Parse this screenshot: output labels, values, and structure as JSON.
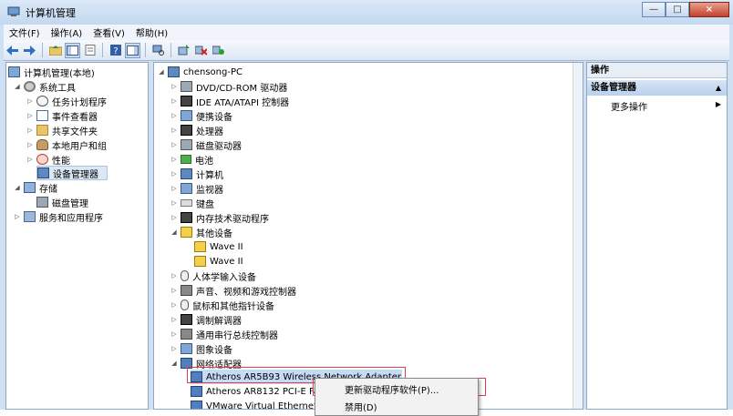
{
  "window": {
    "title": "计算机管理",
    "close_label": "×",
    "max_label": "□",
    "min_label": "—"
  },
  "menu": [
    "文件(F)",
    "操作(A)",
    "查看(V)",
    "帮助(H)"
  ],
  "left_tree": [
    {
      "label": "计算机管理(本地)",
      "icon": "computer-manage-icon"
    },
    {
      "label": "系统工具",
      "icon": "tools-icon"
    },
    {
      "label": "任务计划程序",
      "icon": "clock-icon"
    },
    {
      "label": "事件查看器",
      "icon": "event-viewer-icon"
    },
    {
      "label": "共享文件夹",
      "icon": "shared-folder-icon"
    },
    {
      "label": "本地用户和组",
      "icon": "users-icon"
    },
    {
      "label": "性能",
      "icon": "performance-icon"
    },
    {
      "label": "设备管理器",
      "icon": "device-manager-icon"
    },
    {
      "label": "存储",
      "icon": "storage-icon"
    },
    {
      "label": "磁盘管理",
      "icon": "disk-icon"
    },
    {
      "label": "服务和应用程序",
      "icon": "services-icon"
    }
  ],
  "device_tree": {
    "root": "chensong-PC",
    "items": [
      "DVD/CD-ROM 驱动器",
      "IDE ATA/ATAPI 控制器",
      "便携设备",
      "处理器",
      "磁盘驱动器",
      "电池",
      "计算机",
      "监视器",
      "键盘",
      "内存技术驱动程序",
      "其他设备",
      "Wave II",
      "Wave II",
      "人体学输入设备",
      "声音、视频和游戏控制器",
      "鼠标和其他指针设备",
      "调制解调器",
      "通用串行总线控制器",
      "图象设备",
      "网络适配器",
      "Atheros AR5B93 Wireless Network Adapter",
      "Atheros AR8132 PCI-E Fas",
      "VMware Virtual Ethernet A"
    ]
  },
  "context_menu": {
    "update": "更新驱动程序软件(P)...",
    "disable": "禁用(D)"
  },
  "actions": {
    "header": "操作",
    "section": "设备管理器",
    "more": "更多操作"
  },
  "colors": {
    "highlight_box": "#e0404a",
    "title_bar": "#c3d8ef"
  }
}
